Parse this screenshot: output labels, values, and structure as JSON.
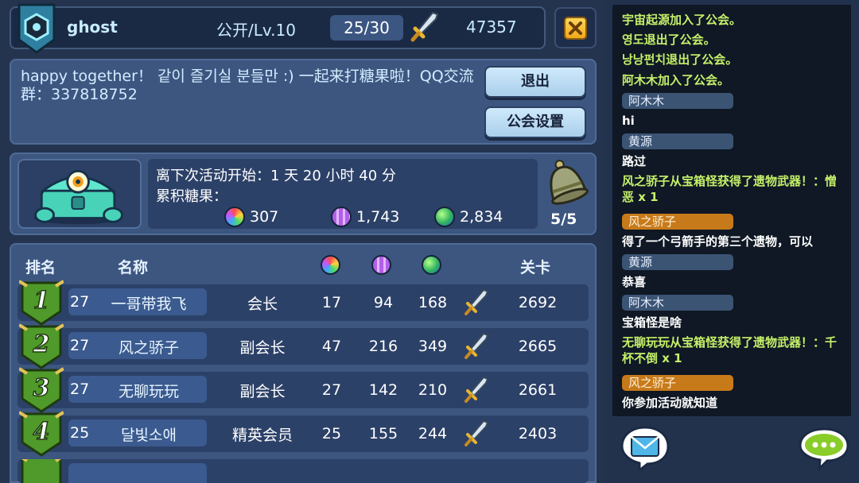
{
  "guild": {
    "name": "ghost",
    "level": "公开/Lv.10",
    "members": "25/30",
    "power": "47357"
  },
  "notice": {
    "text": "happy together！ 같이 즐기실 분들만 :) 一起来打糖果啦！QQ交流群：337818752",
    "quit_label": "退出",
    "settings_label": "公会设置"
  },
  "event": {
    "countdown": "离下次活动开始：1 天 20 小时 40 分",
    "candy_label": "累积糖果：",
    "candies": [
      {
        "icon": "rainbow-candy-icon",
        "value": "307"
      },
      {
        "icon": "purple-candy-icon",
        "value": "1,743"
      },
      {
        "icon": "green-candy-icon",
        "value": "2,834"
      }
    ],
    "bell_count": "5/5"
  },
  "ranking": {
    "headers": {
      "rank": "排名",
      "name": "名称",
      "stage": "关卡"
    },
    "rows": [
      {
        "badge": "1",
        "level": "27",
        "name": "一哥带我飞",
        "role": "会长",
        "c1": "17",
        "c2": "94",
        "c3": "168",
        "stage": "2692"
      },
      {
        "badge": "2",
        "level": "27",
        "name": "风之骄子",
        "role": "副会长",
        "c1": "47",
        "c2": "216",
        "c3": "349",
        "stage": "2665"
      },
      {
        "badge": "3",
        "level": "27",
        "name": "无聊玩玩",
        "role": "副会长",
        "c1": "27",
        "c2": "142",
        "c3": "210",
        "stage": "2661"
      },
      {
        "badge": "4",
        "level": "25",
        "name": "달빛소애",
        "role": "精英会员",
        "c1": "25",
        "c2": "155",
        "c3": "244",
        "stage": "2403"
      }
    ]
  },
  "chat": {
    "messages": [
      {
        "kind": "sys",
        "text": "宇宙起源加入了公会。"
      },
      {
        "kind": "sys",
        "text": "영도退出了公会。"
      },
      {
        "kind": "sys",
        "text": "낭낭펀치退出了公会。"
      },
      {
        "kind": "sys",
        "text": "阿木木加入了公会。"
      },
      {
        "kind": "name",
        "text": "阿木木"
      },
      {
        "kind": "msg",
        "text": "hi"
      },
      {
        "kind": "name",
        "text": "黄源"
      },
      {
        "kind": "msg",
        "text": "路过"
      },
      {
        "kind": "sys",
        "text": "风之骄子从宝箱怪获得了遗物武器！：憎恶 x 1"
      },
      {
        "kind": "vip",
        "text": "风之骄子"
      },
      {
        "kind": "msg",
        "text": "得了一个弓箭手的第三个遗物，可以"
      },
      {
        "kind": "name",
        "text": "黄源"
      },
      {
        "kind": "msg",
        "text": "恭喜"
      },
      {
        "kind": "name",
        "text": "阿木木"
      },
      {
        "kind": "msg",
        "text": "宝箱怪是啥"
      },
      {
        "kind": "sys",
        "text": "无聊玩玩从宝箱怪获得了遗物武器！：千杯不倒 x 1"
      },
      {
        "kind": "vip",
        "text": "风之骄子"
      },
      {
        "kind": "msg",
        "text": "你参加活动就知道"
      }
    ]
  },
  "colors": {
    "background": "#24344f",
    "panel": "#3c5680",
    "row": "#2c4168",
    "chat_system_text": "#c5f06a",
    "vip_name": "#c77a1a",
    "badge_green": "#4f9a2a"
  }
}
